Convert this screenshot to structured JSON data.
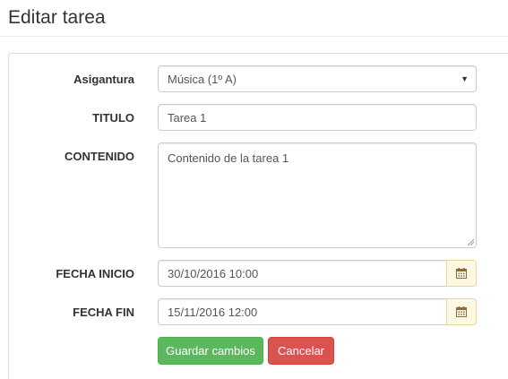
{
  "page": {
    "title": "Editar tarea"
  },
  "form": {
    "subject": {
      "label": "Asigantura",
      "value": "Música (1º A)"
    },
    "title_field": {
      "label": "TITULO",
      "value": "Tarea 1"
    },
    "content": {
      "label": "CONTENIDO",
      "value": "Contenido de la tarea 1"
    },
    "start_date": {
      "label": "FECHA INICIO",
      "value": "30/10/2016 10:00",
      "icon": "calendar-icon"
    },
    "end_date": {
      "label": "FECHA FIN",
      "value": "15/11/2016 12:00",
      "icon": "calendar-icon"
    }
  },
  "actions": {
    "save_label": "Guardar cambios",
    "cancel_label": "Cancelar"
  },
  "colors": {
    "save": "#5cb85c",
    "cancel": "#d9534f",
    "addon_bg": "#fcf8e3",
    "calendar_icon": "#8a6d3b"
  }
}
